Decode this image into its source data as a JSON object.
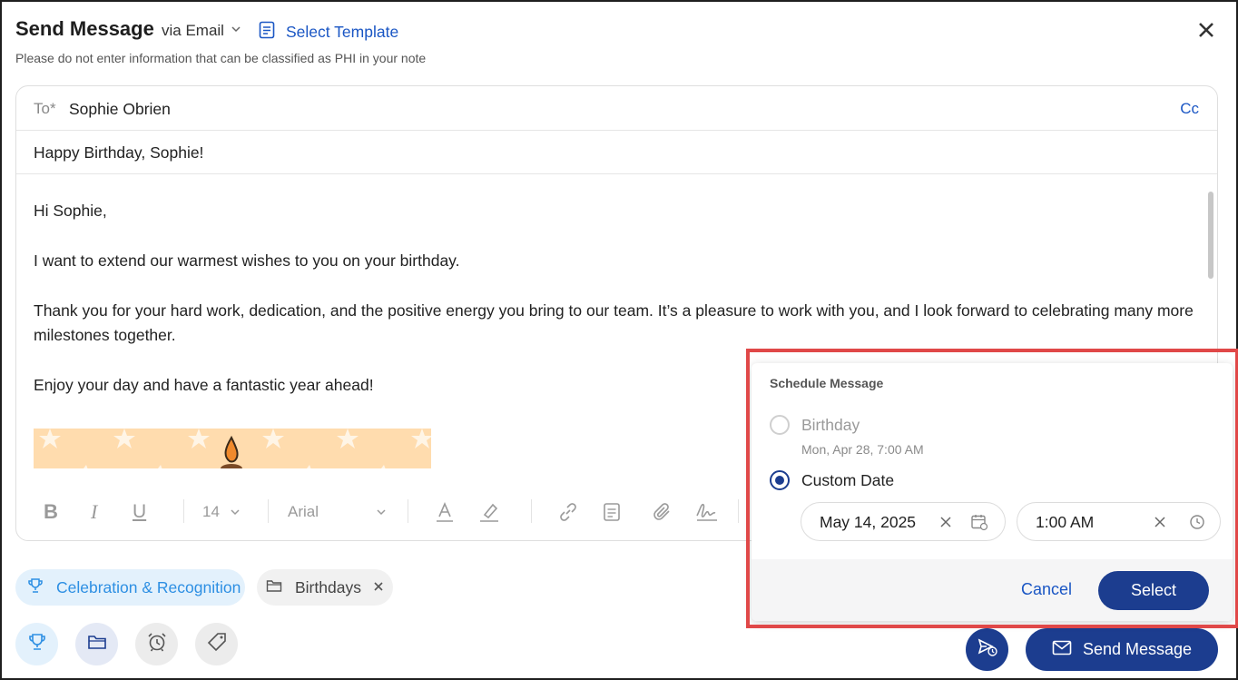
{
  "header": {
    "title": "Send Message",
    "channel": "via Email",
    "select_template": "Select Template",
    "phi_note": "Please do not enter information that can be classified as PHI in your note"
  },
  "compose": {
    "to_label": "To*",
    "to_value": "Sophie Obrien",
    "cc_label": "Cc",
    "subject": "Happy Birthday, Sophie!",
    "body": [
      "Hi Sophie,",
      "I want to extend our warmest wishes to you on your birthday.",
      "Thank you for your hard work, dedication, and the positive energy you bring to our team. It’s a pleasure to work with you, and I look forward to celebrating many more milestones together.",
      "Enjoy your day and have a fantastic year ahead!"
    ]
  },
  "toolbar": {
    "font_size": "14",
    "font_family": "Arial"
  },
  "chips": {
    "category": "Celebration & Recognition",
    "folder": "Birthdays"
  },
  "schedule": {
    "title": "Schedule Message",
    "option_birthday": "Birthday",
    "option_birthday_sub": "Mon, Apr 28, 7:00 AM",
    "option_custom": "Custom Date",
    "selected_option": "Custom Date",
    "date_value": "May 14, 2025",
    "time_value": "1:00 AM",
    "cancel": "Cancel",
    "select": "Select"
  },
  "footer": {
    "send_label": "Send Message"
  },
  "colors": {
    "primary": "#1c3d8f",
    "link": "#1a56c4",
    "highlight": "#e04848",
    "chip_category_bg": "#e3f1fc",
    "banner": "#ffdcae"
  }
}
